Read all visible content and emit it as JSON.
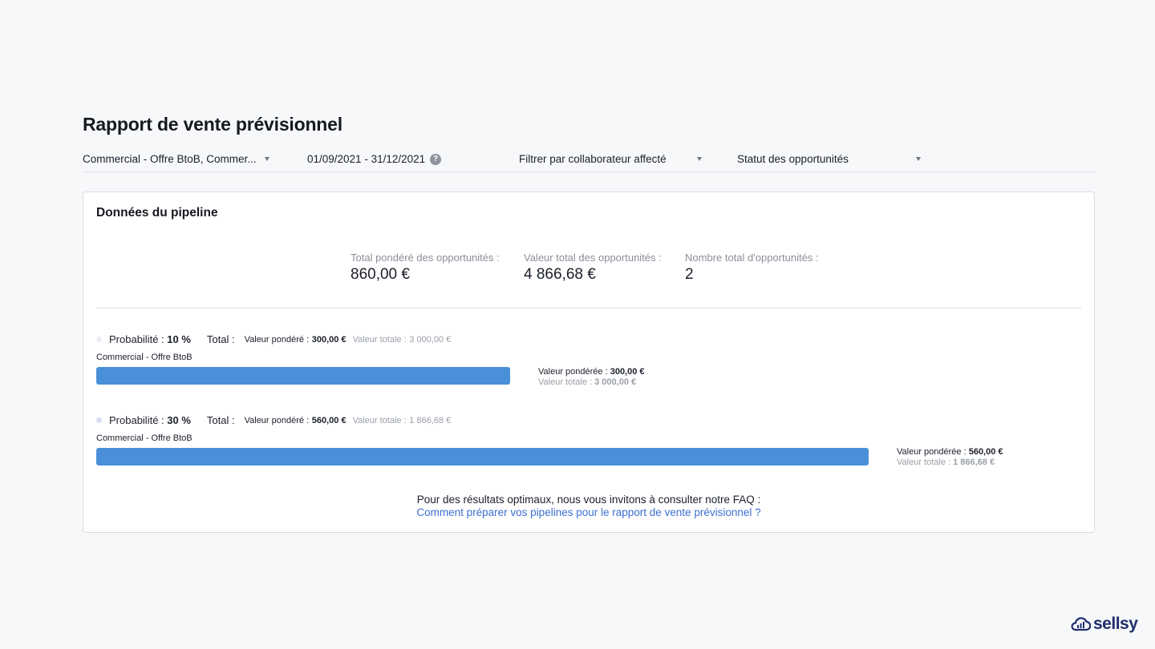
{
  "page": {
    "title": "Rapport de vente prévisionnel"
  },
  "filters": {
    "pipelines": "Commercial - Offre BtoB, Commer...",
    "date_range": "01/09/2021 - 31/12/2021",
    "help": "?",
    "collaborator_placeholder": "Filtrer par collaborateur affecté",
    "status_placeholder": "Statut des opportunités"
  },
  "card": {
    "title": "Données du pipeline",
    "stats": [
      {
        "label": "Total pondéré des opportunités :",
        "value": "860,00 €"
      },
      {
        "label": "Valeur total des opportunités :",
        "value": "4 866,68 €"
      },
      {
        "label": "Nombre total d'opportunités :",
        "value": "2"
      }
    ],
    "groups": [
      {
        "prob_label": "Probabilité :",
        "prob_value": "10 %",
        "total_label": "Total :",
        "weighted_label": "Valeur pondéré :",
        "weighted_value": "300,00 €",
        "total_value_label": "Valeur totale :",
        "total_value": "3 000,00 €",
        "pipeline": "Commercial - Offre BtoB",
        "bar_fraction": 0.5356,
        "legend_weighted_label": "Valeur pondérée :",
        "legend_weighted_value": "300,00 €",
        "legend_total_label": "Valeur totale :",
        "legend_total_value": "3 000,00 €",
        "dot_color": "#eceef4"
      },
      {
        "prob_label": "Probabilité :",
        "prob_value": "30 %",
        "total_label": "Total :",
        "weighted_label": "Valeur pondéré :",
        "weighted_value": "560,00 €",
        "total_value_label": "Valeur totale :",
        "total_value": "1 866,68 €",
        "pipeline": "Commercial - Offre BtoB",
        "bar_fraction": 1.0,
        "legend_weighted_label": "Valeur pondérée :",
        "legend_weighted_value": "560,00 €",
        "legend_total_label": "Valeur totale :",
        "legend_total_value": "1 866,68 €",
        "dot_color": "#d7dcf0"
      }
    ],
    "faq_text": "Pour des résultats optimaux, nous vous invitons à consulter notre FAQ :",
    "faq_link": "Comment préparer vos pipelines pour le rapport de vente prévisionnel ?"
  },
  "brand": {
    "name": "sellsy",
    "color": "#1f2d6b",
    "bar_color": "#4a90d9",
    "link_color": "#3d6fd1"
  }
}
